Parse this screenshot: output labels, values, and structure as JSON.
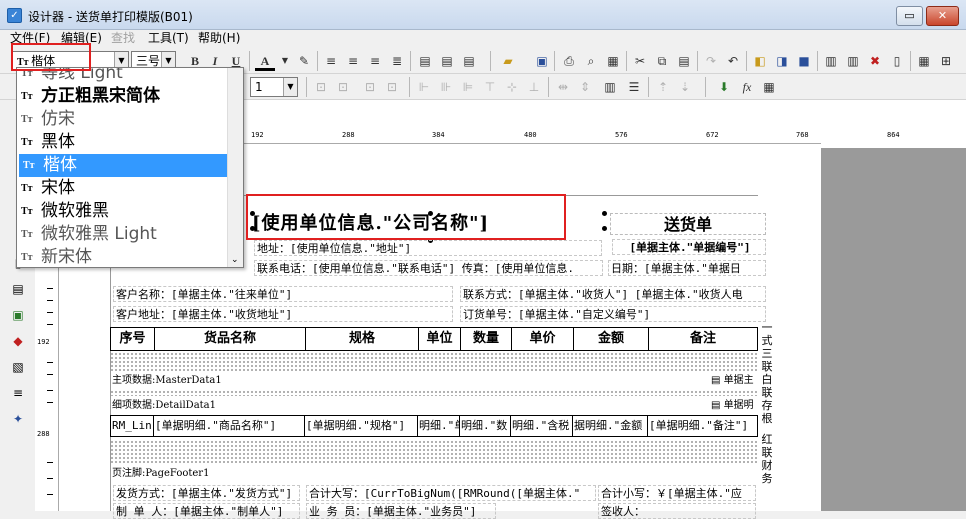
{
  "window": {
    "icon": "app-icon",
    "title": "设计器 - 送货单打印模版(B01)",
    "btn_restore": "▭",
    "btn_close": "✕"
  },
  "menu": {
    "file": "文件(F)",
    "edit": "编辑(E)",
    "find": "查找",
    "tools": "工具(T)",
    "help": "帮助(H)"
  },
  "toolbar": {
    "font_value": "楷体",
    "size_value": "三号",
    "bold": "B",
    "italic": "I",
    "underline": "U",
    "color": "A",
    "line_value": "1"
  },
  "font_dropdown": {
    "items": [
      {
        "label": "等线 Light",
        "selected": false
      },
      {
        "label": "方正粗黑宋简体",
        "selected": false
      },
      {
        "label": "仿宋",
        "selected": false
      },
      {
        "label": "黑体",
        "selected": false
      },
      {
        "label": "楷体",
        "selected": true
      },
      {
        "label": "宋体",
        "selected": false
      },
      {
        "label": "微软雅黑",
        "selected": false
      },
      {
        "label": "微软雅黑 Light",
        "selected": false
      },
      {
        "label": "新宋体",
        "selected": false
      }
    ],
    "icon": "Tт"
  },
  "ruler": {
    "h_labels": [
      "192",
      "288",
      "384",
      "480",
      "576",
      "672",
      "768",
      "864"
    ],
    "v_labels": [
      "192",
      "288"
    ]
  },
  "report": {
    "company": "[使用单位信息.\"公司名称\"]",
    "doc_title": "送货单",
    "doc_no": "[单据主体.\"单据编号\"]",
    "address": "地址：[使用单位信息.\"地址\"]",
    "phone": "联系电话：[使用单位信息.\"联系电话\"] 传真：[使用单位信息.",
    "date": "日期：[单据主体.\"单据日",
    "customer": "客户名称：[单据主体.\"往来单位\"]",
    "contact": "联系方式：[单据主体.\"收货人\"] [单据主体.\"收货人电",
    "cust_addr": "客户地址：[单据主体.\"收货地址\"]",
    "order_no": "订货单号：[单据主体.\"自定义编号\"]",
    "headers": [
      "序号",
      "货品名称",
      "规格",
      "单位",
      "数量",
      "单价",
      "金额",
      "备注"
    ],
    "master_band": "主项数据:MasterData1",
    "master_right": "单据主",
    "detail_band": "细项数据:DetailData1",
    "detail_right": "单据明",
    "detail_cells": [
      "RM_Lin",
      "[单据明细.\"商品名称\"]",
      "[单据明细.\"规格\"]",
      "明细.\"单",
      "明细.\"数",
      "明细.\"含税",
      "据明细.\"金额",
      "[单据明细.\"备注\"]"
    ],
    "footer_band": "页注脚:PageFooter1",
    "ship_method": "发货方式：[单据主体.\"发货方式\"]",
    "total_upper": "合计大写：[CurrToBigNum([RMRound([单据主体.\"",
    "total_lower": "合计小写：￥[单据主体.\"应",
    "maker": "制 单 人：[单据主体.\"制单人\"]",
    "salesman": "业 务 员：[单据主体.\"业务员\"]",
    "signer": "签收人：",
    "side_text": [
      "一",
      "式",
      "三",
      "联",
      "白",
      "联",
      "存",
      "根",
      "红",
      "联",
      "财",
      "务"
    ]
  }
}
